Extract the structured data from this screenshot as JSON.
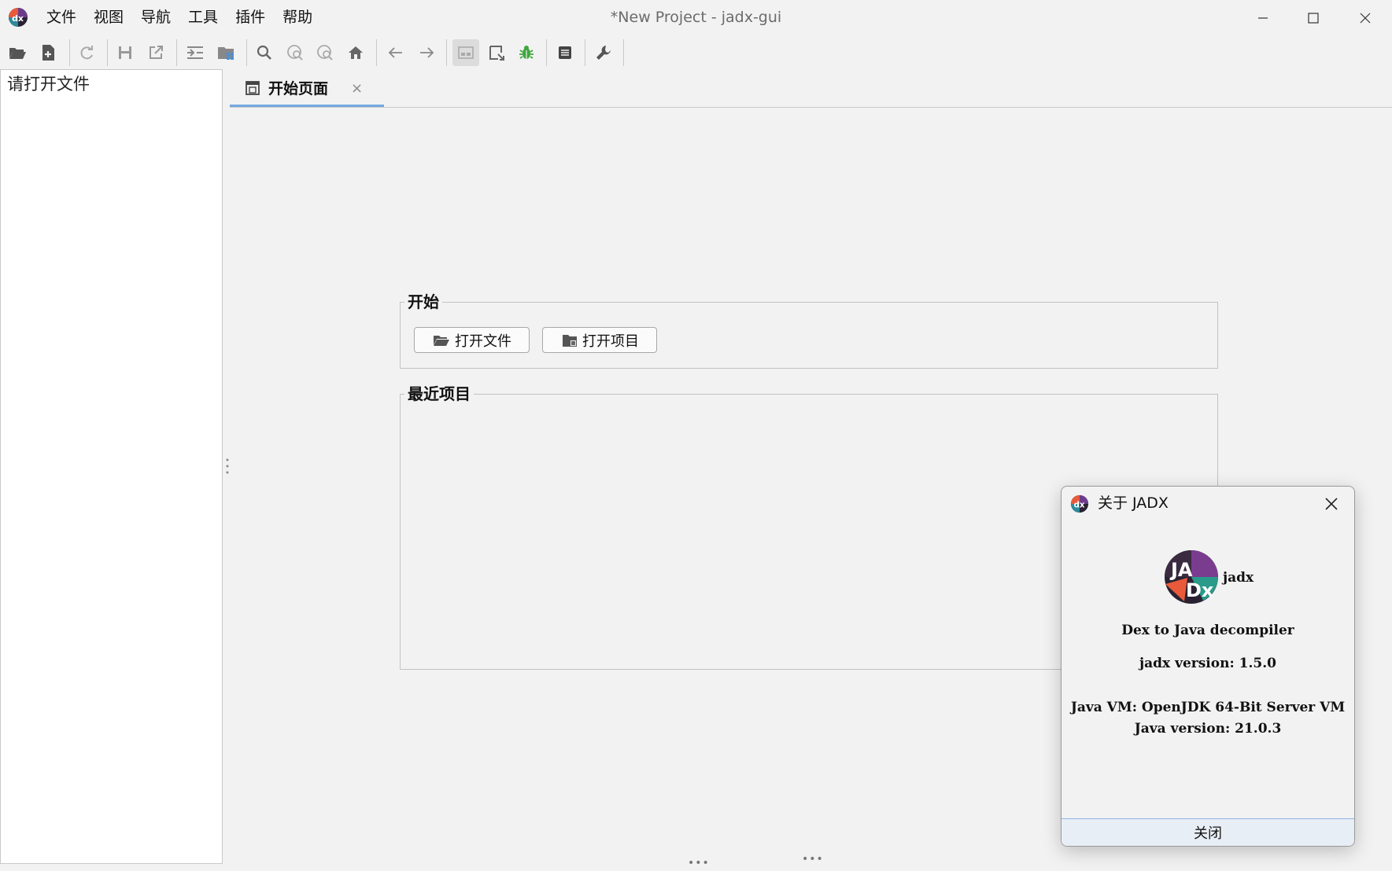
{
  "window": {
    "title": "*New Project - jadx-gui",
    "menu": [
      "文件",
      "视图",
      "导航",
      "工具",
      "插件",
      "帮助"
    ]
  },
  "toolbar": {
    "icons": [
      "open-file-icon",
      "add-file-icon",
      "reload-icon",
      "save-icon",
      "export-icon",
      "sync-tree-icon",
      "flatten-packages-icon",
      "search-icon",
      "find-class-icon",
      "find-usage-icon",
      "home-icon",
      "back-arrow-icon",
      "forward-arrow-icon",
      "decompile-all-icon",
      "quick-tabs-icon",
      "debugger-icon",
      "log-viewer-icon",
      "preferences-icon"
    ]
  },
  "tree": {
    "empty_message": "请打开文件"
  },
  "tabs": [
    {
      "label": "开始页面",
      "close": "×"
    }
  ],
  "start_page": {
    "start_group": {
      "title": "开始",
      "open_file_button": "打开文件",
      "open_project_button": "打开项目"
    },
    "recent_group": {
      "title": "最近项目"
    }
  },
  "about_dialog": {
    "title": "关于 JADX",
    "app_name": "jadx",
    "tagline": "Dex to Java decompiler",
    "version": "jadx version: 1.5.0",
    "jvm": "Java VM: OpenJDK 64-Bit Server VM",
    "java_version": "Java version: 21.0.3",
    "close_button": "关闭"
  },
  "colors": {
    "accent": "#4a90d9",
    "debug_green": "#3fa63f",
    "background": "#f2f2f2"
  }
}
